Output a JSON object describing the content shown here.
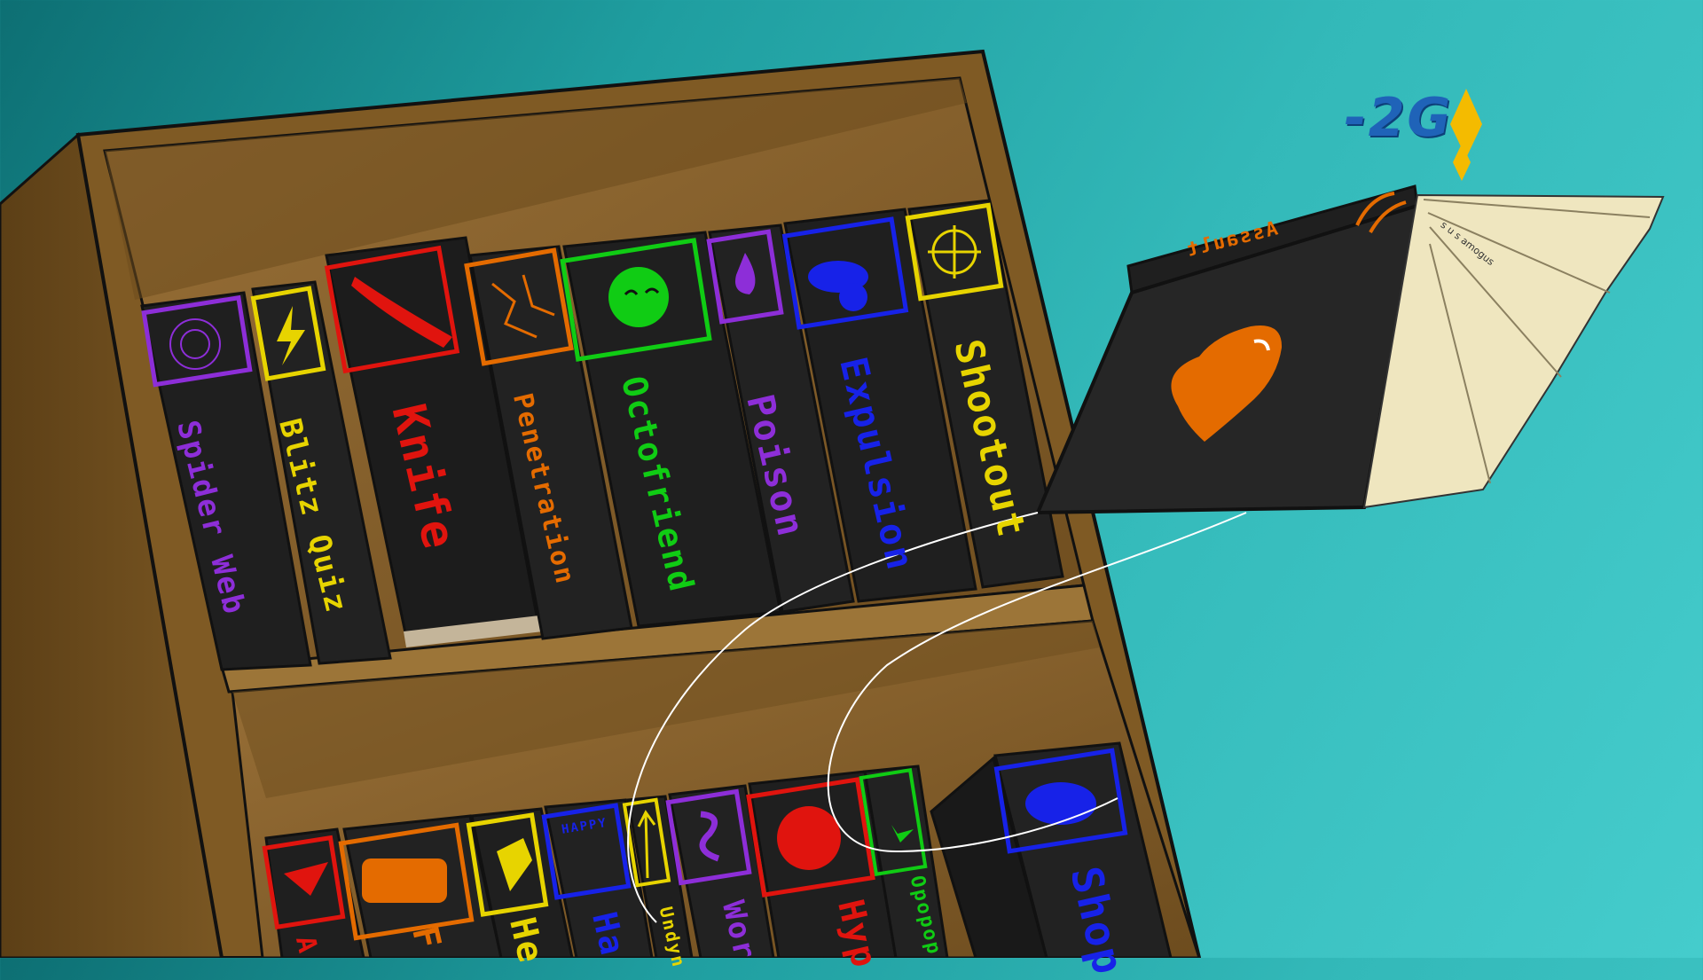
{
  "scene": {
    "background_colors": [
      "#0d6f73",
      "#45cccc"
    ],
    "shelf_wood_color": "#8a6530"
  },
  "flying_book": {
    "cover_title": "Assault",
    "cover_color": "#222222",
    "accent_color": "#e46b00",
    "emblem_icon": "heart-icon",
    "page_signature": "s u s amogus"
  },
  "cost": {
    "label": "-2G",
    "color": "#1f63b8",
    "sparkle_color": "#f4bb00"
  },
  "top_shelf_books": [
    {
      "title": "Spider Web",
      "color": "#8d2ed8",
      "icon": "spider-web-icon"
    },
    {
      "title": "Blitz Quiz",
      "color": "#e7d400",
      "icon": "lightning-icon"
    },
    {
      "title": "Knife",
      "color": "#e0140e",
      "icon": "knife-icon"
    },
    {
      "title": "Penetration",
      "color": "#e46b00",
      "icon": "cracked-icon"
    },
    {
      "title": "Octofriend",
      "color": "#10cc14",
      "icon": "octopus-icon"
    },
    {
      "title": "Poison",
      "color": "#8d2ed8",
      "icon": "drop-icon"
    },
    {
      "title": "Expulsion",
      "color": "#1722e8",
      "icon": "cannon-icon"
    },
    {
      "title": "Shootout",
      "color": "#e7d400",
      "icon": "crosshair-icon"
    }
  ],
  "bottom_shelf_books": [
    {
      "title": "A",
      "color": "#e0140e",
      "icon": "star-icon"
    },
    {
      "title": "F",
      "color": "#e46b00",
      "icon": "monster-group-icon"
    },
    {
      "title": "He",
      "color": "#e7d400",
      "icon": "hand-icon"
    },
    {
      "title": "Ha",
      "color": "#1722e8",
      "icon": "happy-badge-icon",
      "badge_text": "HAPPY"
    },
    {
      "title": "Undyn",
      "color": "#e7d400",
      "icon": "arrow-up-icon"
    },
    {
      "title": "Wor",
      "color": "#8d2ed8",
      "icon": "worm-icon"
    },
    {
      "title": "Hyp",
      "color": "#e0140e",
      "icon": "demon-icon"
    },
    {
      "title": "Opopop",
      "color": "#10cc14",
      "icon": "sparkle-plus-icon"
    },
    {
      "title": "Shop",
      "color": "#1722e8",
      "icon": "creature-icon"
    }
  ]
}
